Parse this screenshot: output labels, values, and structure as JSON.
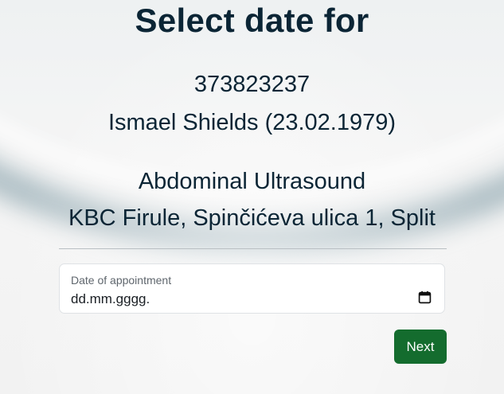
{
  "page": {
    "title": "Select date for",
    "patient_id": "373823237",
    "patient_name_dob": "Ismael Shields (23.02.1979)",
    "procedure": "Abdominal Ultrasound",
    "location": "KBC Firule, Spinčićeva ulica 1, Split"
  },
  "form": {
    "date_label": "Date of appointment",
    "date_value": "dd.mm.gggg.",
    "calendar_icon": "calendar-icon"
  },
  "actions": {
    "next_label": "Next"
  },
  "colors": {
    "primary_button": "#146c2e",
    "heading_text": "#0b2535"
  }
}
